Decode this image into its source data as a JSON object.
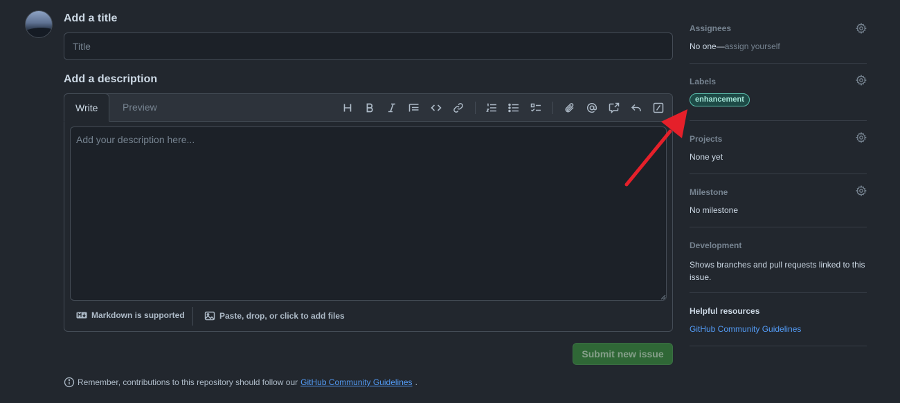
{
  "title_section": {
    "heading": "Add a title",
    "placeholder": "Title"
  },
  "description_section": {
    "heading": "Add a description",
    "tabs": [
      "Write",
      "Preview"
    ],
    "placeholder": "Add your description here...",
    "markdown_label": "Markdown is supported",
    "files_label": "Paste, drop, or click to add files"
  },
  "submit_label": "Submit new issue",
  "remember": {
    "prefix": "Remember, contributions to this repository should follow our ",
    "link": "GitHub Community Guidelines",
    "suffix": "."
  },
  "sidebar": {
    "assignees": {
      "heading": "Assignees",
      "value_prefix": "No one—",
      "value_link": "assign yourself"
    },
    "labels": {
      "heading": "Labels",
      "label": "enhancement"
    },
    "projects": {
      "heading": "Projects",
      "value": "None yet"
    },
    "milestone": {
      "heading": "Milestone",
      "value": "No milestone"
    },
    "development": {
      "heading": "Development",
      "value": "Shows branches and pull requests linked to this issue."
    },
    "helpful": {
      "heading": "Helpful resources",
      "link": "GitHub Community Guidelines"
    }
  },
  "colors": {
    "background": "#22272e",
    "accent_link": "#539bf5",
    "submit": "#347d39",
    "label_border": "#5bc0ae",
    "annotation_arrow": "#e5202a"
  }
}
